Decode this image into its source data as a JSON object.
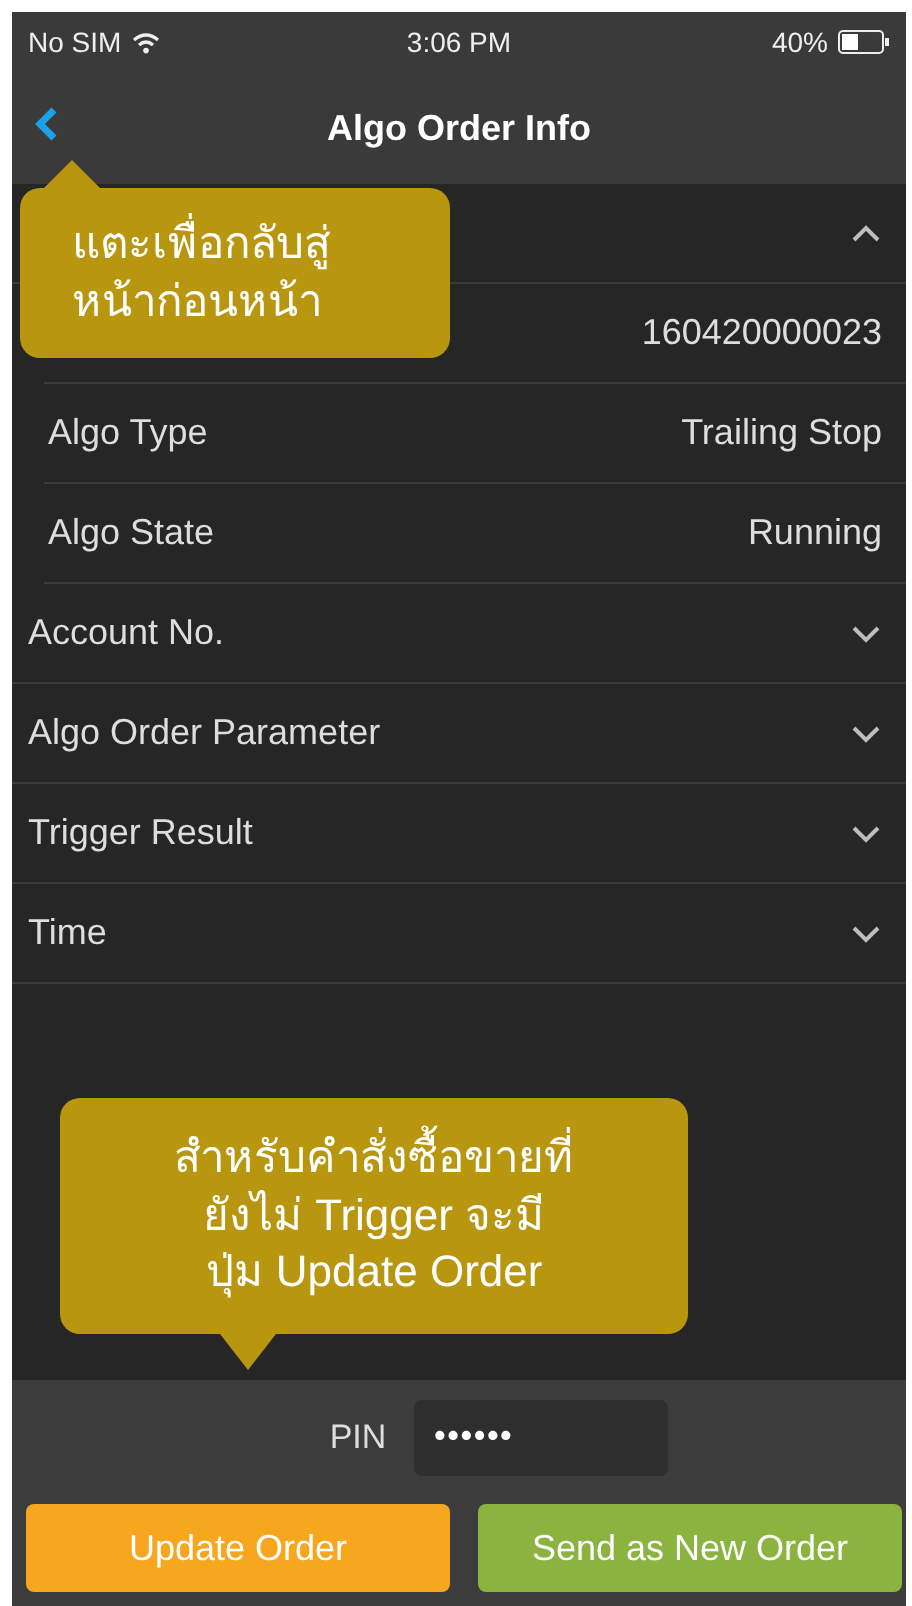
{
  "status_bar": {
    "carrier": "No SIM",
    "time": "3:06 PM",
    "battery": "40%"
  },
  "nav": {
    "title": "Algo Order Info"
  },
  "sections": [
    {
      "expanded": true,
      "rows": [
        {
          "value": "160420000023"
        },
        {
          "label": "Algo Type",
          "value": "Trailing Stop"
        },
        {
          "label": "Algo State",
          "value": "Running"
        }
      ]
    },
    {
      "label": "Account No.",
      "expanded": false
    },
    {
      "label": "Algo Order Parameter",
      "expanded": false
    },
    {
      "label": "Trigger Result",
      "expanded": false
    },
    {
      "label": "Time",
      "expanded": false
    }
  ],
  "pin": {
    "label": "PIN",
    "value": "••••••"
  },
  "buttons": [
    {
      "label": "Update Order",
      "kind": "update"
    },
    {
      "label": "Send as New Order",
      "kind": "send"
    }
  ],
  "tooltips": [
    {
      "lines": [
        "แตะเพื่อกลับสู่",
        "หน้าก่อนหน้า"
      ],
      "kind": "pointer-up"
    },
    {
      "lines": [
        "สำหรับคำสั่งซื้อขายที่",
        "ยังไม่ Trigger จะมี",
        "ปุ่ม Update Order"
      ],
      "kind": "pointer-down"
    }
  ]
}
